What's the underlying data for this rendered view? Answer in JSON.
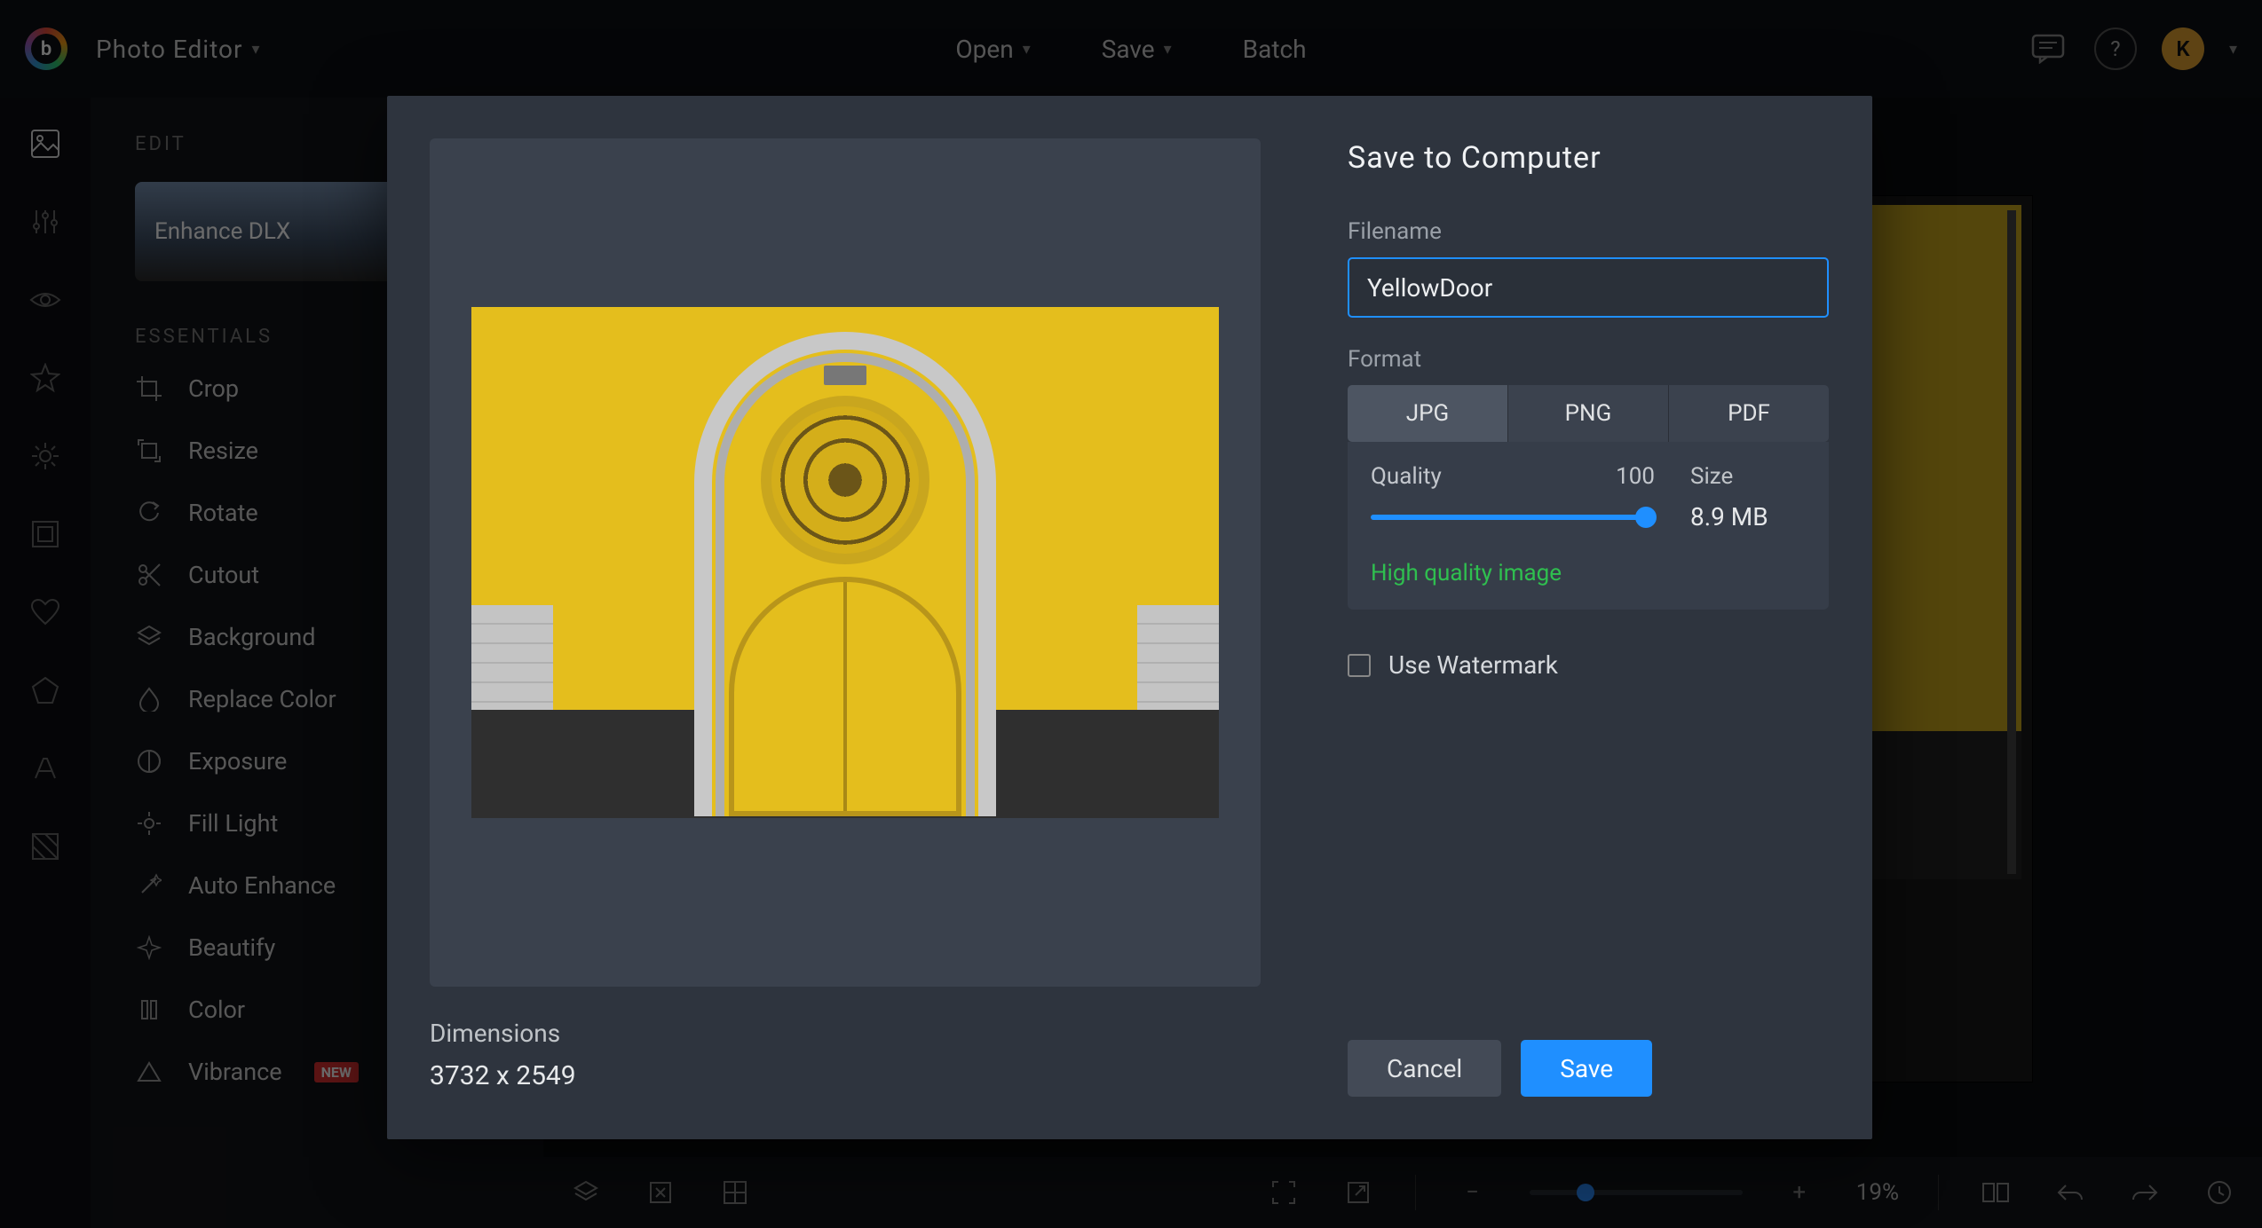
{
  "header": {
    "app_menu": "Photo Editor",
    "open": "Open",
    "save": "Save",
    "batch": "Batch",
    "avatar_letter": "K"
  },
  "sidebar": {
    "section_edit": "EDIT",
    "enhance_card": "Enhance DLX",
    "section_essentials": "ESSENTIALS",
    "tools": [
      "Crop",
      "Resize",
      "Rotate",
      "Cutout",
      "Background",
      "Replace Color",
      "Exposure",
      "Fill Light",
      "Auto Enhance",
      "Beautify",
      "Color",
      "Vibrance"
    ],
    "new_badge": "NEW"
  },
  "bottom": {
    "zoom_pct": "19%"
  },
  "modal": {
    "title": "Save to Computer",
    "filename_label": "Filename",
    "filename_value": "YellowDoor",
    "format_label": "Format",
    "formats": [
      "JPG",
      "PNG",
      "PDF"
    ],
    "quality_label": "Quality",
    "quality_value": "100",
    "size_label": "Size",
    "size_value": "8.9 MB",
    "quality_msg": "High quality image",
    "watermark_label": "Use Watermark",
    "dimensions_label": "Dimensions",
    "dimensions_value": "3732 x 2549",
    "cancel": "Cancel",
    "save": "Save"
  }
}
